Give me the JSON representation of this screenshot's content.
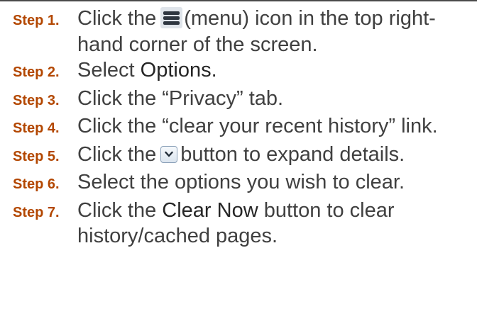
{
  "steps": [
    {
      "label": "Step 1.",
      "before": "Click the",
      "icon": "menu-icon",
      "after": "(menu) icon in the top right-hand corner of the screen."
    },
    {
      "label": "Step 2.",
      "before": "Select ",
      "emphasis": "Options."
    },
    {
      "label": "Step 3.",
      "text": "Click the “Privacy” tab."
    },
    {
      "label": "Step 4.",
      "text": "Click the “clear your recent history” link."
    },
    {
      "label": "Step 5.",
      "before": "Click the",
      "icon": "chevron-down-icon",
      "after": "button to expand details."
    },
    {
      "label": "Step 6.",
      "text": "Select the options you wish to clear."
    },
    {
      "label": "Step 7.",
      "before": "Click the ",
      "emphasis": "Clear Now",
      "after": " button to clear history/cached pages."
    }
  ],
  "colors": {
    "step_label": "#b34700",
    "body_text": "#404040",
    "emphasis_text": "#262626",
    "rule": "#4a4a4a"
  }
}
